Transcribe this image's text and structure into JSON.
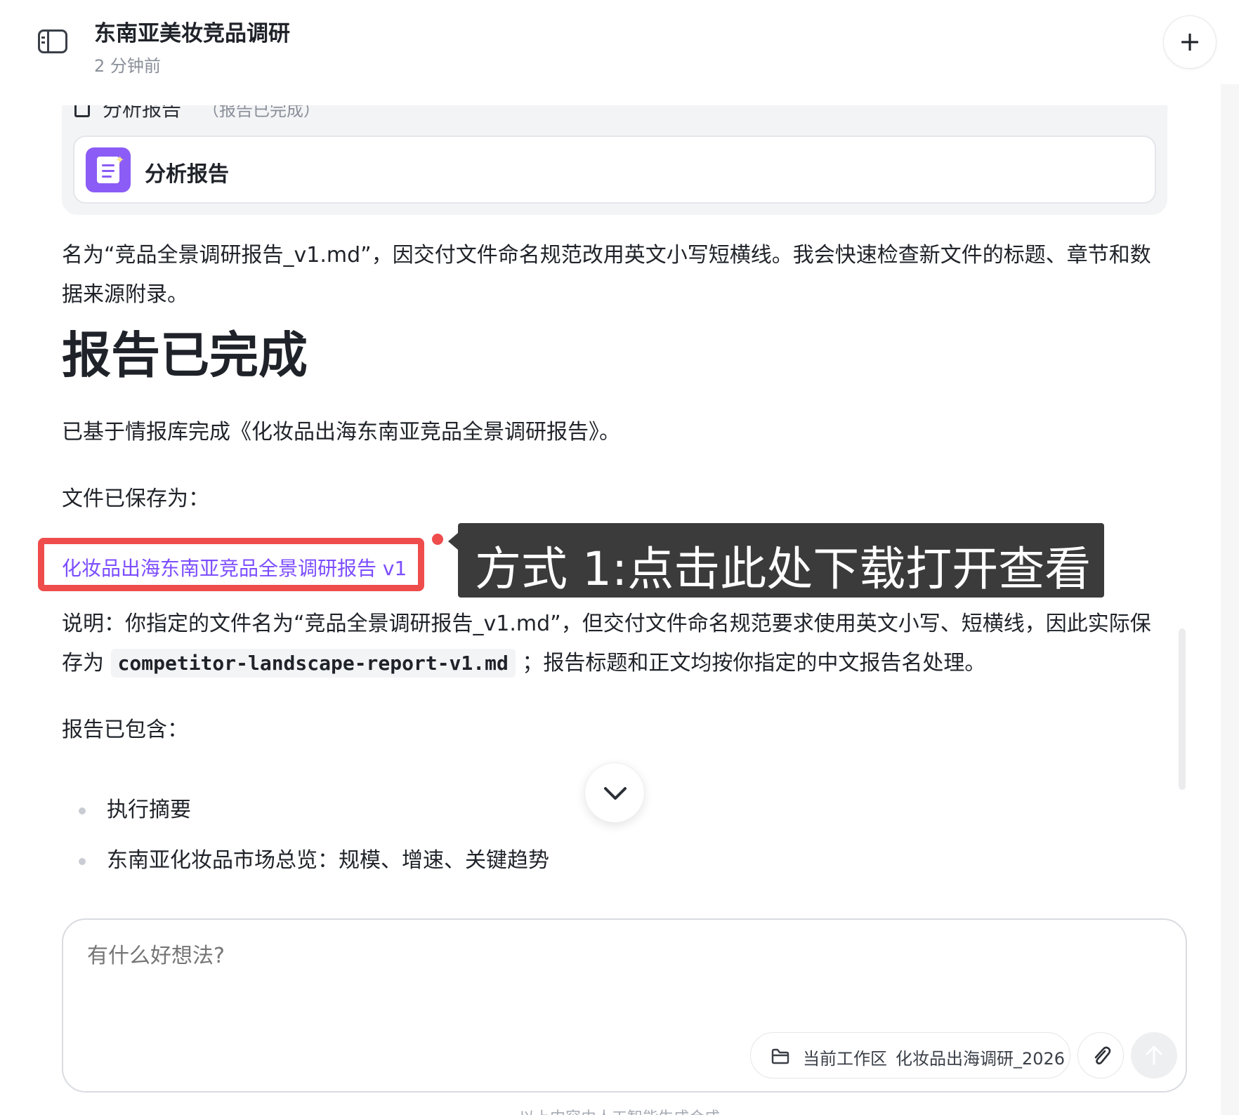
{
  "header": {
    "title": "东南亚美妆竞品调研",
    "time": "2 分钟前",
    "new_chat_label": "+"
  },
  "card": {
    "cut_item": "分析报告",
    "cut_status": "（报告已完成）",
    "artifact_label": "分析报告"
  },
  "message": {
    "intro": "名为“竞品全景调研报告_v1.md”，因交付文件命名规范改用英文小写短横线。我会快速检查新文件的标题、章节和数据来源附录。",
    "heading": "报告已完成",
    "summary": "已基于情报库完成《化妆品出海东南亚竞品全景调研报告》。",
    "saved_as_label": "文件已保存为：",
    "file_link": "化妆品出海东南亚竞品全景调研报告 v1",
    "note_prefix": "说明：你指定的文件名为“竞品全景调研报告_v1.md”，但交付文件命名规范要求使用英文小写、短横线，因此实际保存为 ",
    "note_code": "competitor-landscape-report-v1.md",
    "note_suffix": " ；报告标题和正文均按你指定的中文报告名处理。",
    "contains_label": "报告已包含：",
    "bullets": [
      "执行摘要",
      "东南亚化妆品市场总览：规模、增速、关键趋势"
    ]
  },
  "callout": {
    "text": "方式 1:点击此处下载打开查看"
  },
  "composer": {
    "placeholder": "有什么好想法?",
    "workspace_label": "当前工作区",
    "workspace_name": "化妆品出海调研_2026"
  },
  "footer": {
    "note": "以上内容由人工智能生成合成"
  },
  "colors": {
    "accent_purple": "#8b5cf6",
    "link_purple": "#7c4dff",
    "highlight_red": "#ef4c4c",
    "callout_bg": "#3b3b3b"
  }
}
